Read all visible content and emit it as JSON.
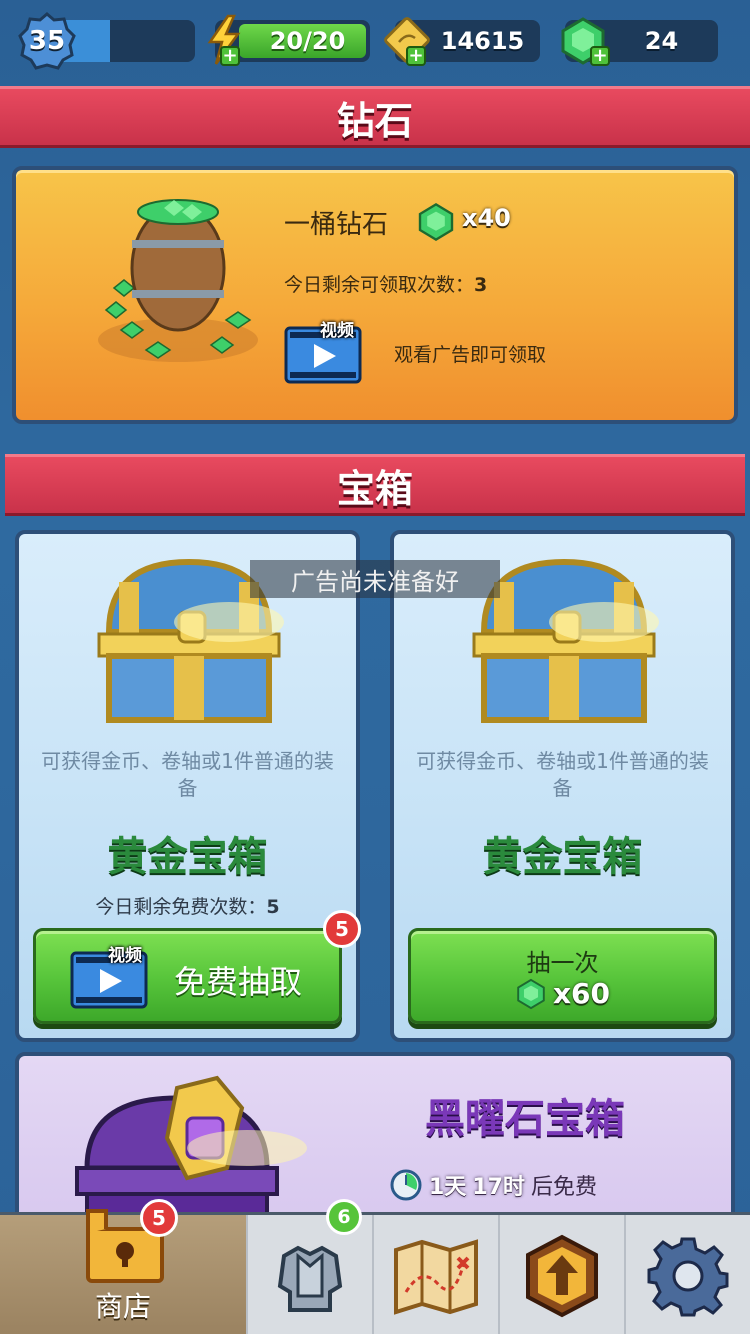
{
  "topbar": {
    "level": "35",
    "level_progress": 0.45,
    "energy": "20/20",
    "scrolls": "14615",
    "gems": "24"
  },
  "sections": {
    "diamond_title": "钻石",
    "chest_title": "宝箱"
  },
  "diamond_offer": {
    "title": "一桶钻石",
    "quantity": "x40",
    "remaining_label": "今日剩余可领取次数：",
    "remaining_value": "3",
    "video_tag": "视频",
    "watch_text": "观看广告即可领取"
  },
  "toast": "广告尚未准备好",
  "chests": [
    {
      "description": "可获得金币、卷轴或1件普通的装备",
      "name": "黄金宝箱",
      "remaining_label": "今日剩余免费次数：",
      "remaining_value": "5",
      "video_tag": "视频",
      "button_label": "免费抽取",
      "badge": "5"
    },
    {
      "description": "可获得金币、卷轴或1件普通的装备",
      "name": "黄金宝箱",
      "button_label": "抽一次",
      "cost": "x60"
    }
  ],
  "obsidian": {
    "name": "黑曜石宝箱",
    "days": "1天",
    "hours": "17时",
    "suffix": "后免费"
  },
  "nav": {
    "shop_label": "商店",
    "shop_badge": "5",
    "gear_badge": "6"
  },
  "colors": {
    "banner_red": "#e84a5f",
    "gem_green": "#3ecf6a",
    "button_green": "#56c43a",
    "gold_title": "#2a8a3c",
    "obsidian_title": "#7a38b8"
  },
  "icons": [
    "level-badge-icon",
    "lightning-icon",
    "scroll-icon",
    "gem-icon",
    "video-icon",
    "clock-icon",
    "shop-chest-icon",
    "armor-icon",
    "map-icon",
    "upgrade-arrow-icon",
    "settings-gear-icon"
  ]
}
